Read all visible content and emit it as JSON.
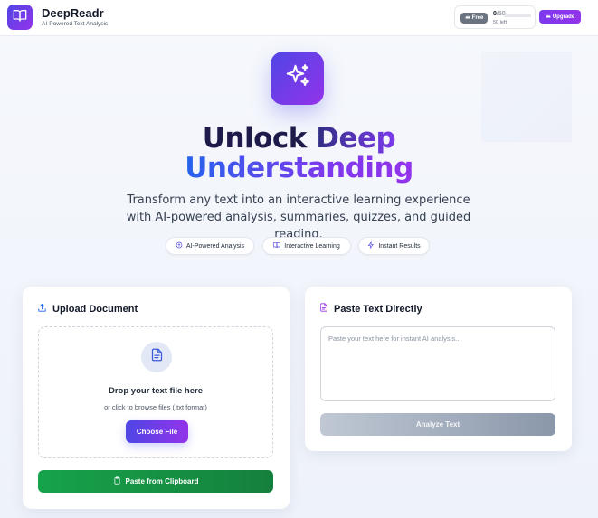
{
  "header": {
    "brand_name": "DeepReadr",
    "brand_subtitle": "AI-Powered Text Analysis",
    "plan_label": "Free",
    "usage_used": "0",
    "usage_total": "/50",
    "usage_fraction": 0,
    "usage_left": "50 left",
    "upgrade_label": "Upgrade"
  },
  "hero": {
    "title_line1_part1": "Unlock",
    "title_line1_part2": "Deep",
    "title_line2": "Understanding",
    "description": "Transform any text into an interactive learning experience with AI-powered analysis, summaries, quizzes, and guided reading.",
    "features": [
      {
        "label": "AI-Powered Analysis",
        "icon": "brain-icon"
      },
      {
        "label": "Interactive Learning",
        "icon": "book-open-icon"
      },
      {
        "label": "Instant Results",
        "icon": "lightning-icon"
      }
    ]
  },
  "upload": {
    "title": "Upload Document",
    "drop_title": "Drop your text file here",
    "drop_subtitle": "or click to browse files (.txt format)",
    "choose_label": "Choose File",
    "clipboard_label": "Paste from Clipboard"
  },
  "paste": {
    "title": "Paste Text Directly",
    "placeholder": "Paste your text here for instant AI analysis...",
    "analyze_label": "Analyze Text"
  },
  "colors": {
    "brand_start": "#4f46e5",
    "brand_end": "#9333ea",
    "clipboard_green": "#16a34a",
    "disabled_gray": "#8a97aa"
  }
}
